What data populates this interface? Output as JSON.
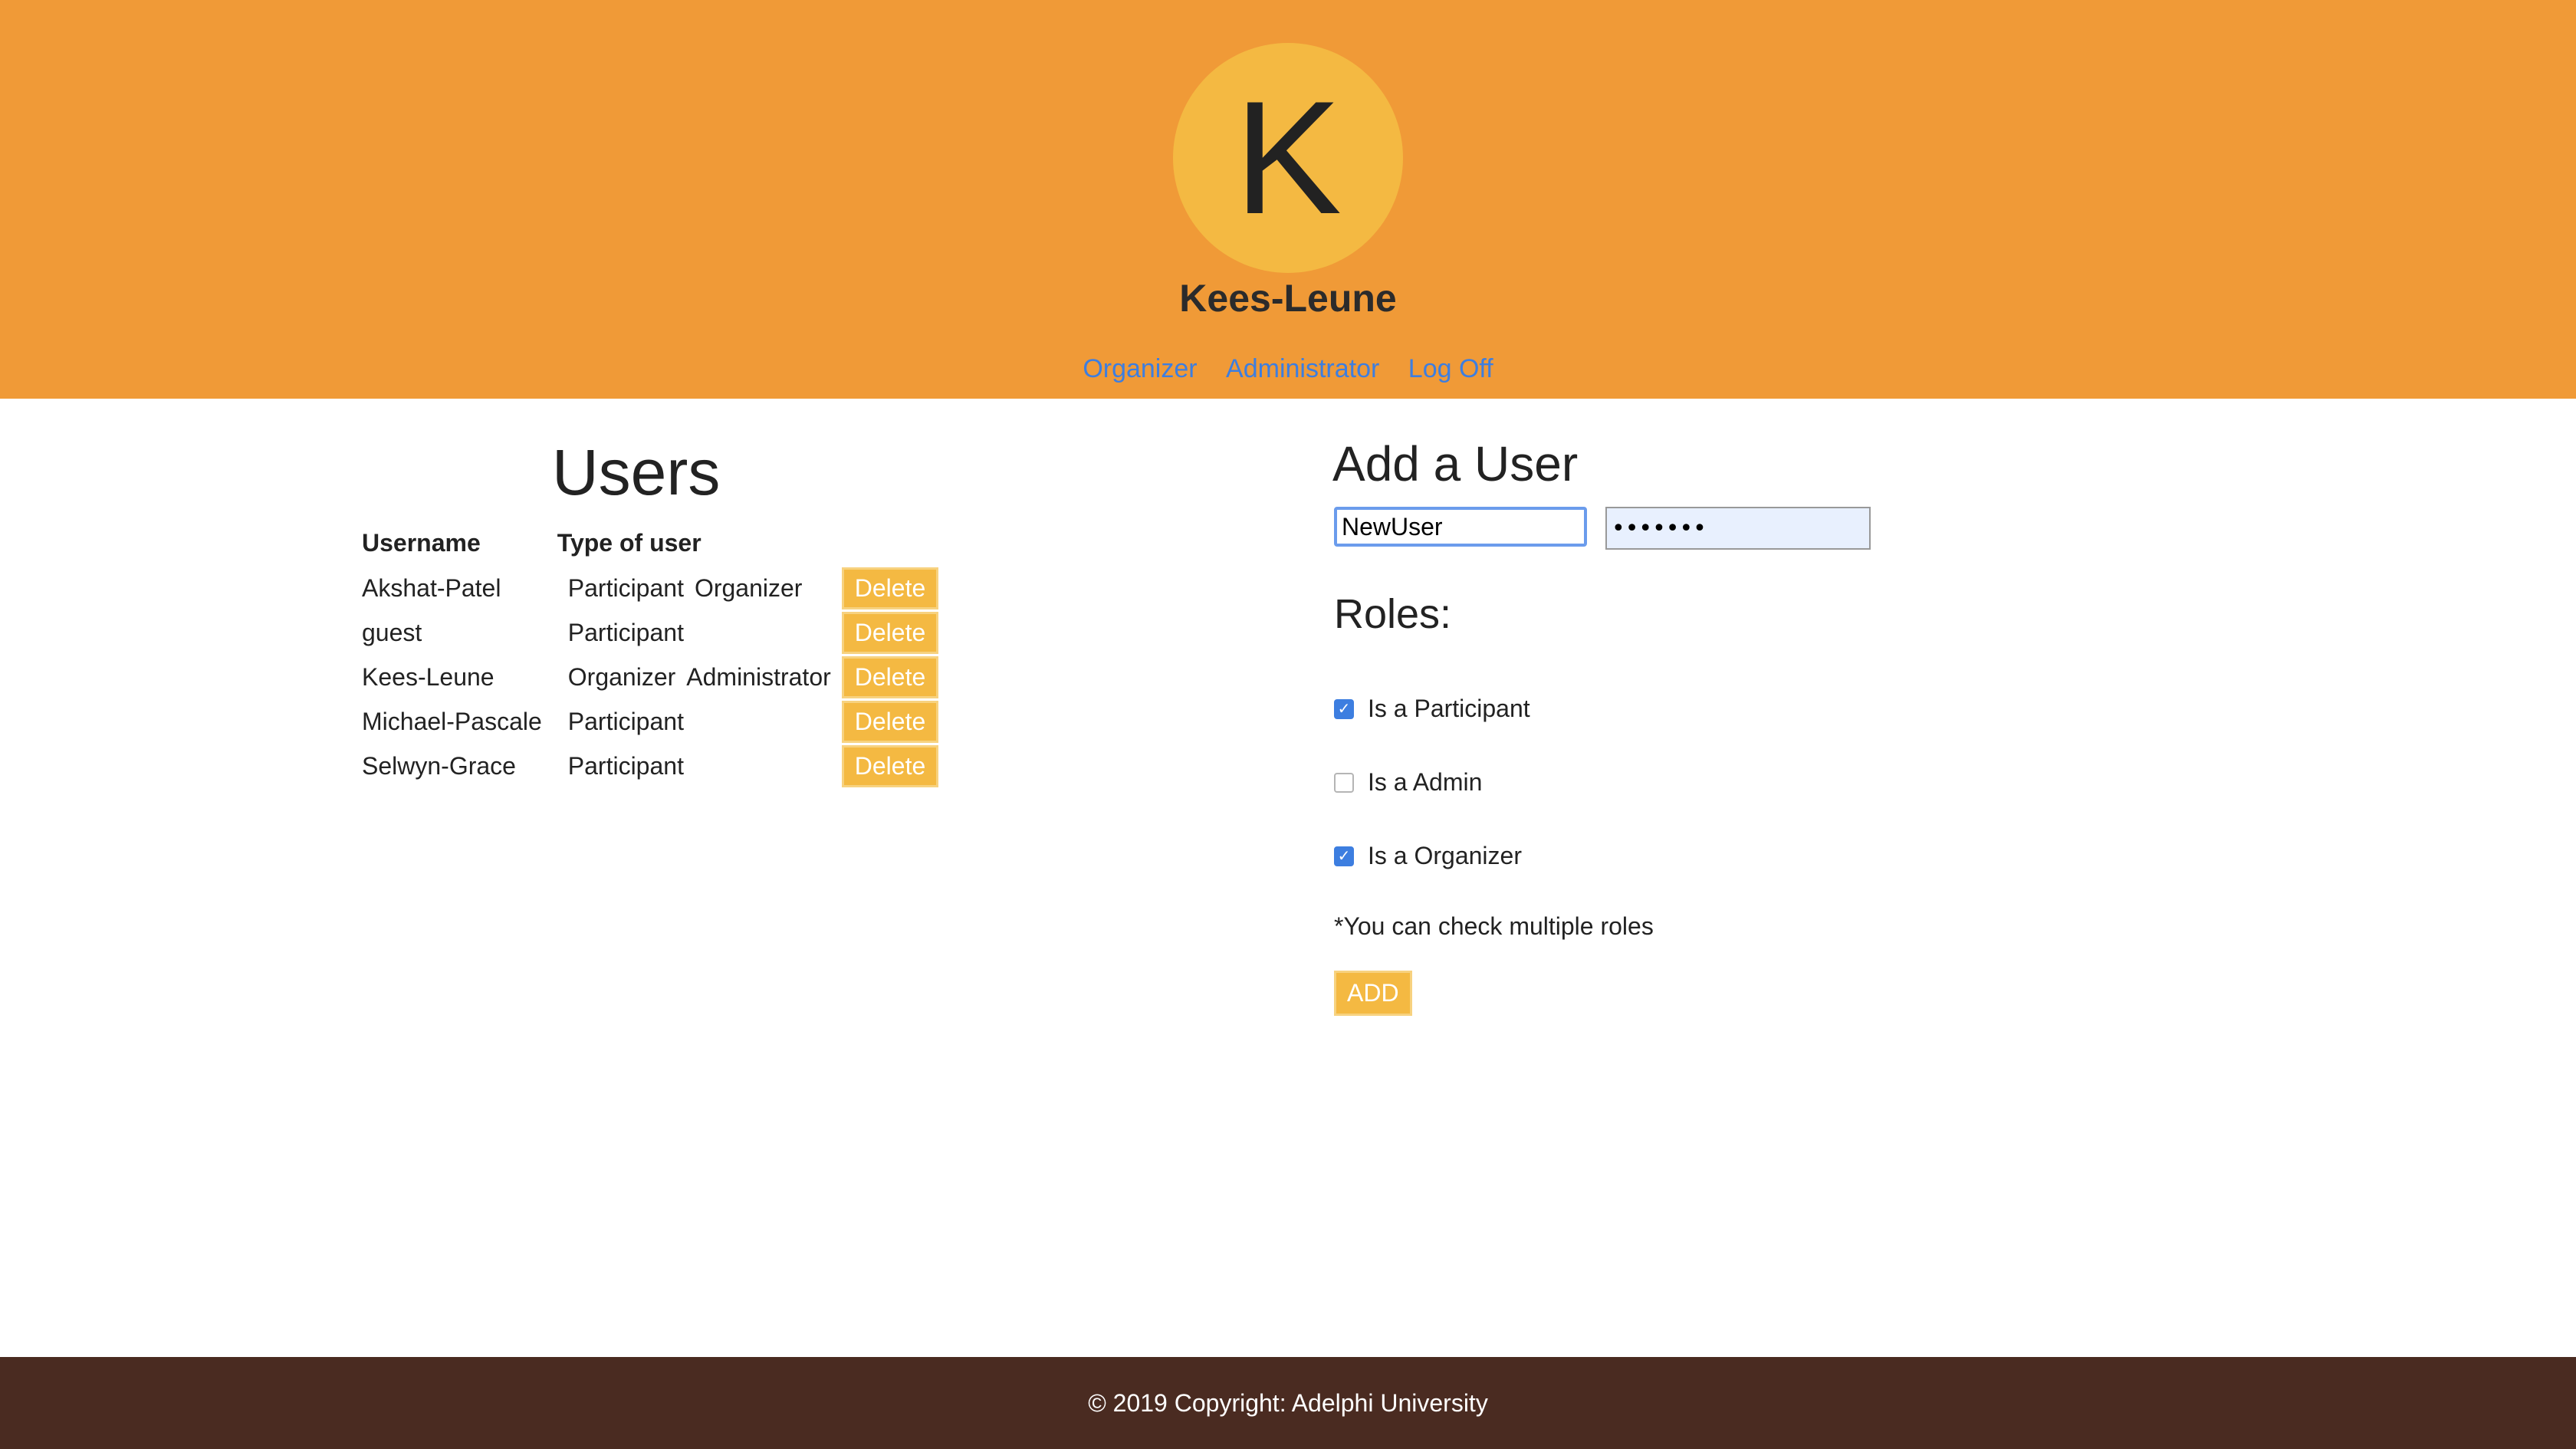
{
  "header": {
    "avatar_letter": "K",
    "profile_name": "Kees-Leune",
    "nav": [
      "Organizer",
      "Administrator",
      "Log Off"
    ],
    "background_color": "#f09a37",
    "avatar_color": "#f4b942"
  },
  "users": {
    "title": "Users",
    "columns": [
      "Username",
      "Type of user"
    ],
    "delete_label": "Delete",
    "rows": [
      {
        "username": "Akshat-Patel",
        "types": [
          "Participant",
          "Organizer"
        ]
      },
      {
        "username": "guest",
        "types": [
          "Participant"
        ]
      },
      {
        "username": "Kees-Leune",
        "types": [
          "Organizer",
          "Administrator"
        ]
      },
      {
        "username": "Michael-Pascale",
        "types": [
          "Participant"
        ]
      },
      {
        "username": "Selwyn-Grace",
        "types": [
          "Participant"
        ]
      }
    ]
  },
  "add_user": {
    "title": "Add a User",
    "username_value": "NewUser",
    "password_value": "•••••••",
    "roles_title": "Roles:",
    "roles": [
      {
        "label": "Is a Participant",
        "checked": true
      },
      {
        "label": "Is a Admin",
        "checked": false
      },
      {
        "label": "Is a Organizer",
        "checked": true
      }
    ],
    "hint": "*You can check multiple roles",
    "add_label": "ADD"
  },
  "footer": {
    "text": "© 2019 Copyright: Adelphi University",
    "background_color": "#4a2b21"
  },
  "colors": {
    "link": "#3d7ee0",
    "button": "#f4b942"
  }
}
